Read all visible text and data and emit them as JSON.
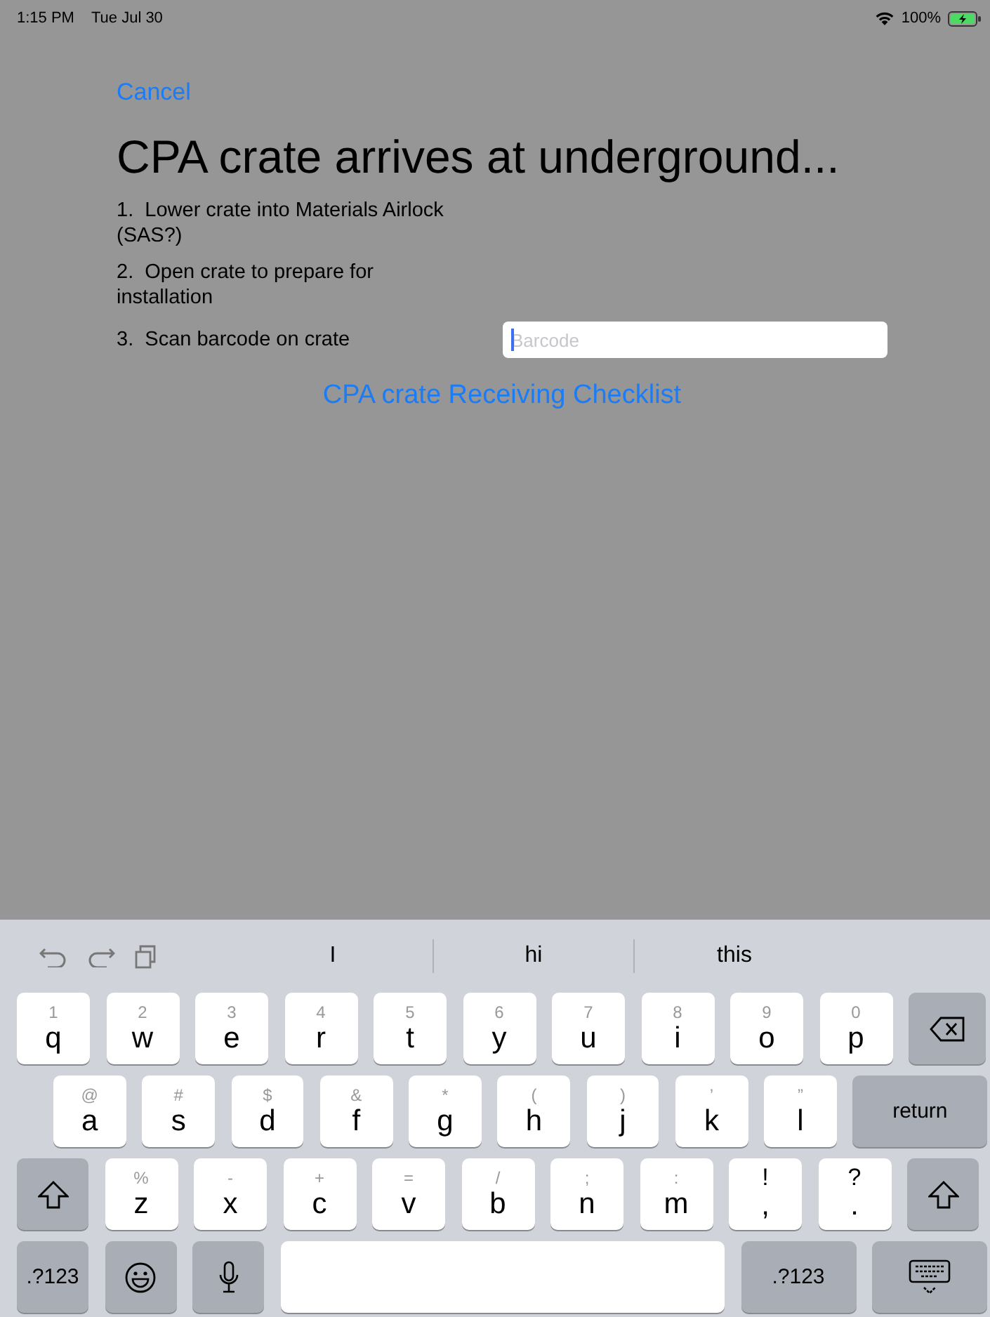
{
  "status_bar": {
    "time": "1:15 PM",
    "date": "Tue Jul 30",
    "battery": "100%"
  },
  "nav": {
    "cancel": "Cancel"
  },
  "title": "CPA crate arrives at underground...",
  "steps": [
    {
      "number": "1.",
      "text": "Lower crate into Materials Airlock (SAS?)"
    },
    {
      "number": "2.",
      "text": "Open crate to prepare for installation"
    },
    {
      "number": "3.",
      "text": "Scan barcode on crate",
      "field": {
        "placeholder": "Barcode"
      }
    }
  ],
  "link": "CPA crate Receiving Checklist",
  "keyboard": {
    "suggestions": [
      "I",
      "hi",
      "this"
    ],
    "rows": [
      [
        {
          "kind": "letter",
          "hint": "1",
          "label": "q"
        },
        {
          "kind": "letter",
          "hint": "2",
          "label": "w"
        },
        {
          "kind": "letter",
          "hint": "3",
          "label": "e"
        },
        {
          "kind": "letter",
          "hint": "4",
          "label": "r"
        },
        {
          "kind": "letter",
          "hint": "5",
          "label": "t"
        },
        {
          "kind": "letter",
          "hint": "6",
          "label": "y"
        },
        {
          "kind": "letter",
          "hint": "7",
          "label": "u"
        },
        {
          "kind": "letter",
          "hint": "8",
          "label": "i"
        },
        {
          "kind": "letter",
          "hint": "9",
          "label": "o"
        },
        {
          "kind": "letter",
          "hint": "0",
          "label": "p"
        },
        {
          "kind": "backspace"
        }
      ],
      [
        {
          "kind": "letter",
          "hint": "@",
          "label": "a"
        },
        {
          "kind": "letter",
          "hint": "#",
          "label": "s"
        },
        {
          "kind": "letter",
          "hint": "$",
          "label": "d"
        },
        {
          "kind": "letter",
          "hint": "&",
          "label": "f"
        },
        {
          "kind": "letter",
          "hint": "*",
          "label": "g"
        },
        {
          "kind": "letter",
          "hint": "(",
          "label": "h"
        },
        {
          "kind": "letter",
          "hint": ")",
          "label": "j"
        },
        {
          "kind": "letter",
          "hint": "’",
          "label": "k"
        },
        {
          "kind": "letter",
          "hint": "”",
          "label": "l"
        },
        {
          "kind": "return",
          "label": "return"
        }
      ],
      [
        {
          "kind": "shift"
        },
        {
          "kind": "letter",
          "hint": "%",
          "label": "z"
        },
        {
          "kind": "letter",
          "hint": "-",
          "label": "x"
        },
        {
          "kind": "letter",
          "hint": "+",
          "label": "c"
        },
        {
          "kind": "letter",
          "hint": "=",
          "label": "v"
        },
        {
          "kind": "letter",
          "hint": "/",
          "label": "b"
        },
        {
          "kind": "letter",
          "hint": ";",
          "label": "n"
        },
        {
          "kind": "letter",
          "hint": ":",
          "label": "m"
        },
        {
          "kind": "symbol",
          "hint": "!",
          "label": ","
        },
        {
          "kind": "symbol",
          "hint": "?",
          "label": "."
        },
        {
          "kind": "shift"
        }
      ],
      [
        {
          "kind": "mode",
          "label": ".?123"
        },
        {
          "kind": "emoji"
        },
        {
          "kind": "mic"
        },
        {
          "kind": "space"
        },
        {
          "kind": "mode-wide",
          "label": ".?123"
        },
        {
          "kind": "dismiss"
        }
      ]
    ]
  }
}
